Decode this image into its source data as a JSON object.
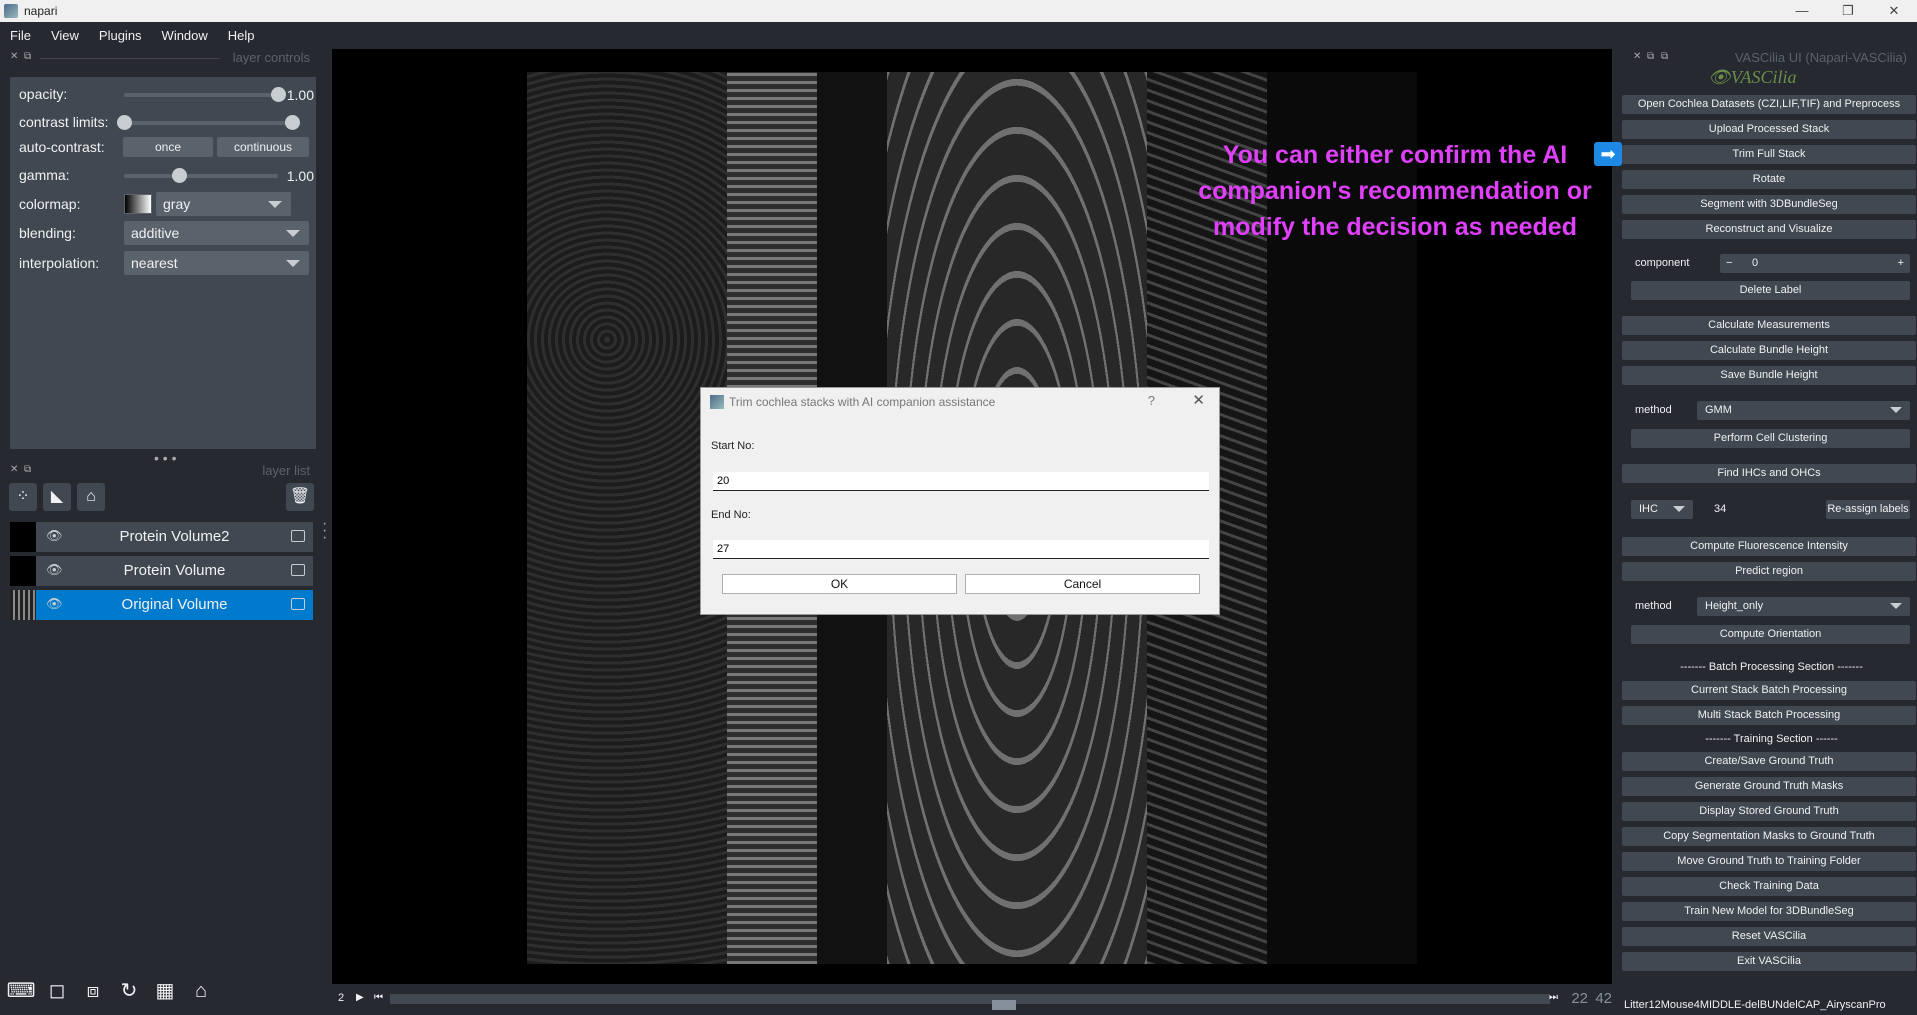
{
  "window": {
    "title": "napari"
  },
  "menu": [
    "File",
    "View",
    "Plugins",
    "Window",
    "Help"
  ],
  "layer_controls": {
    "header": "layer controls",
    "opacity_label": "opacity:",
    "opacity_value": "1.00",
    "opacity_fraction": 1.0,
    "contrast_label": "contrast limits:",
    "autocontrast_label": "auto-contrast:",
    "once": "once",
    "continuous": "continuous",
    "gamma_label": "gamma:",
    "gamma_value": "1.00",
    "gamma_fraction": 0.36,
    "colormap_label": "colormap:",
    "colormap_value": "gray",
    "blending_label": "blending:",
    "blending_value": "additive",
    "interpolation_label": "interpolation:",
    "interpolation_value": "nearest"
  },
  "layer_list": {
    "header": "layer list",
    "layers": [
      "Protein Volume2",
      "Protein Volume",
      "Original Volume"
    ]
  },
  "annotation": {
    "text": "You can either confirm the AI companion's recommendation or modify the decision as needed",
    "arrow": "➡"
  },
  "dialog": {
    "title": "Trim cochlea stacks with AI companion assistance",
    "help": "?",
    "close": "✕",
    "start_label": "Start No:",
    "start_value": "20",
    "end_label": "End No:",
    "end_value": "27",
    "ok": "OK",
    "cancel": "Cancel"
  },
  "dims": {
    "axis": "2",
    "current": "22",
    "total": "42",
    "position_fraction": 0.53
  },
  "plugin": {
    "header": "VASCilia UI (Napari-VASCilia)",
    "logo": "VASCilia",
    "buttons_top": [
      "Open Cochlea Datasets (CZI,LIF,TIF) and Preprocess",
      "Upload Processed Stack",
      "Trim Full Stack",
      "Rotate",
      "Segment with 3DBundleSeg",
      "Reconstruct and Visualize"
    ],
    "component_label": "component",
    "component_value": "0",
    "delete_label": "Delete Label",
    "buttons_mid": [
      "Calculate Measurements",
      "Calculate Bundle Height",
      "Save Bundle Height"
    ],
    "method_label": "method",
    "method1_value": "GMM",
    "cluster": "Perform Cell Clustering",
    "find_ihc": "Find IHCs and OHCs",
    "ihc_value": "IHC",
    "ihc_number": "34",
    "reassign": "Re-assign labels",
    "compute_fluor": "Compute Fluorescence Intensity",
    "predict": "Predict region",
    "method2_value": "Height_only",
    "orientation": "Compute Orientation",
    "batch_section": "------- Batch Processing Section -------",
    "batch_buttons": [
      "Current Stack Batch Processing",
      "Multi Stack Batch Processing"
    ],
    "training_section": "------- Training Section ------",
    "training_buttons": [
      "Create/Save Ground Truth",
      "Generate Ground Truth Masks",
      "Display Stored Ground Truth",
      "Copy Segmentation Masks to Ground Truth",
      "Move Ground Truth to Training Folder",
      "Check Training Data",
      "Train New Model for 3DBundleSeg",
      "Reset VASCilia",
      "Exit VASCilia"
    ]
  },
  "status": {
    "filename": "Litter12Mouse4MIDDLE-delBUNdelCAP_AiryscanPro"
  },
  "colors": {
    "accent": "#007acc",
    "annotation": "#e040fb",
    "panel": "#414851",
    "bg": "#262930"
  }
}
